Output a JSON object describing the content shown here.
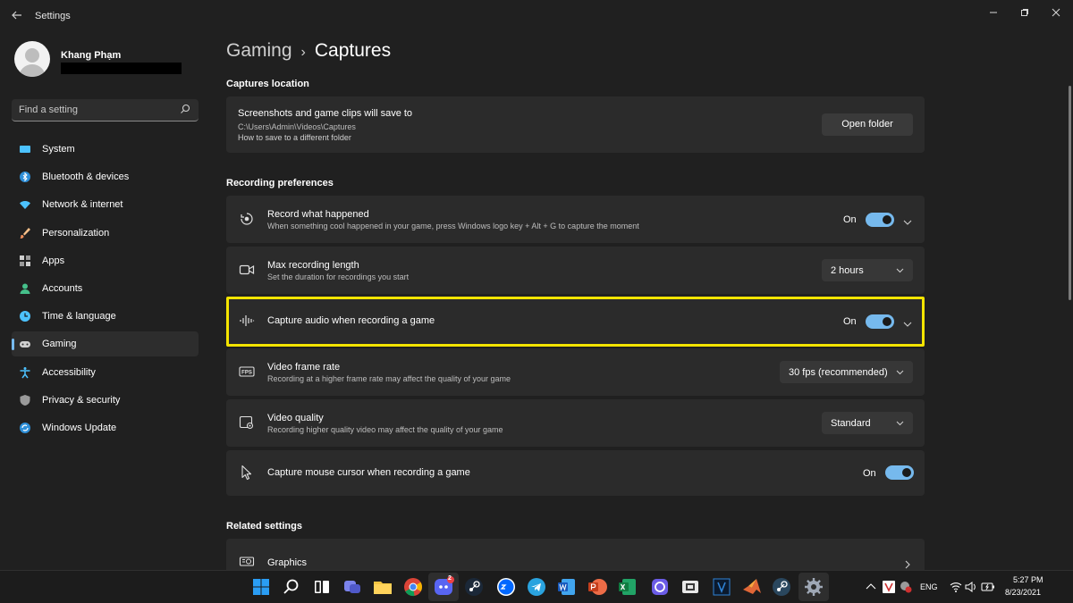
{
  "window": {
    "title": "Settings"
  },
  "user": {
    "name": "Khang Phạm"
  },
  "search": {
    "placeholder": "Find a setting"
  },
  "sidebar": {
    "items": [
      {
        "label": "System",
        "icon": "system-icon",
        "color": "#4cc2ff"
      },
      {
        "label": "Bluetooth & devices",
        "icon": "bluetooth-icon",
        "color": "#4cc2ff"
      },
      {
        "label": "Network & internet",
        "icon": "wifi-icon",
        "color": "#4cc2ff"
      },
      {
        "label": "Personalization",
        "icon": "brush-icon",
        "color": "#f7c08a"
      },
      {
        "label": "Apps",
        "icon": "apps-icon",
        "color": "#cfcfcf"
      },
      {
        "label": "Accounts",
        "icon": "person-icon",
        "color": "#45c08a"
      },
      {
        "label": "Time & language",
        "icon": "globe-clock-icon",
        "color": "#4cc2ff"
      },
      {
        "label": "Gaming",
        "icon": "gamepad-icon",
        "color": "#cfcfcf",
        "active": true
      },
      {
        "label": "Accessibility",
        "icon": "accessibility-icon",
        "color": "#4cc2ff"
      },
      {
        "label": "Privacy & security",
        "icon": "shield-icon",
        "color": "#9a9a9a"
      },
      {
        "label": "Windows Update",
        "icon": "update-icon",
        "color": "#4cc2ff"
      }
    ]
  },
  "breadcrumb": {
    "parent": "Gaming",
    "separator": "›",
    "current": "Captures"
  },
  "captures_location": {
    "section_title": "Captures location",
    "title": "Screenshots and game clips will save to",
    "path": "C:\\Users\\Admin\\Videos\\Captures",
    "link": "How to save to a different folder",
    "button": "Open folder"
  },
  "recording": {
    "section_title": "Recording preferences",
    "record_what_happened": {
      "title": "Record what happened",
      "desc": "When something cool happened in your game, press Windows logo key + Alt + G to capture the moment",
      "state": "On"
    },
    "max_length": {
      "title": "Max recording length",
      "desc": "Set the duration for recordings you start",
      "value": "2 hours"
    },
    "capture_audio": {
      "title": "Capture audio when recording a game",
      "state": "On"
    },
    "frame_rate": {
      "title": "Video frame rate",
      "desc": "Recording at a higher frame rate may affect the quality of your game",
      "value": "30 fps (recommended)"
    },
    "video_quality": {
      "title": "Video quality",
      "desc": "Recording higher quality video may affect the quality of your game",
      "value": "Standard"
    },
    "mouse_cursor": {
      "title": "Capture mouse cursor when recording a game",
      "state": "On"
    }
  },
  "related": {
    "section_title": "Related settings",
    "graphics": "Graphics"
  },
  "taskbar": {
    "discord_badge": "2",
    "tray": {
      "lang": "ENG",
      "time": "5:27 PM",
      "date": "8/23/2021"
    }
  },
  "colors": {
    "accent": "#76b9ed",
    "highlight": "#f4e400"
  }
}
